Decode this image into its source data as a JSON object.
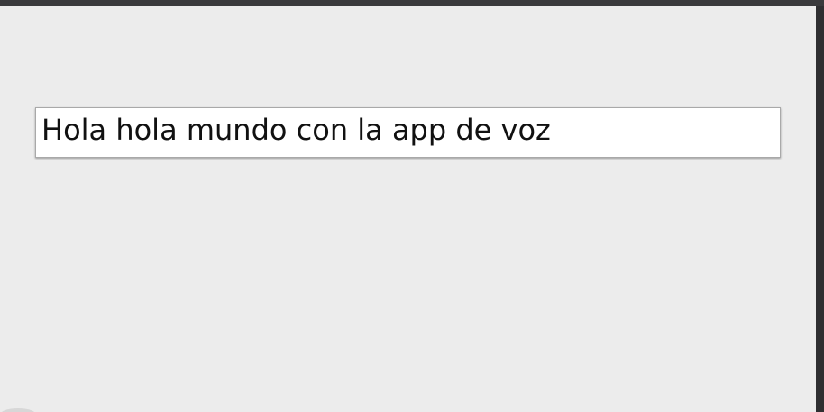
{
  "speech_result": {
    "text": "Hola hola mundo con la app de voz"
  },
  "colors": {
    "background": "#ececec",
    "status_strip": "#3a3a3c",
    "text_box": "#ffffff",
    "text": "#111111"
  }
}
